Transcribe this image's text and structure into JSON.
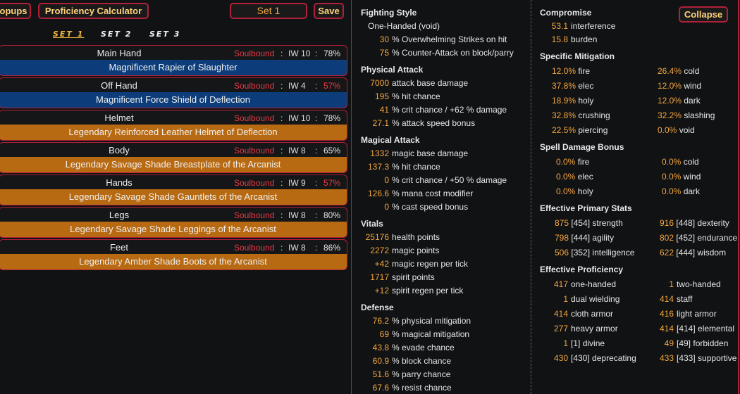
{
  "toolbar": {
    "popups_label": "opups",
    "calculator_label": "Proficiency Calculator",
    "set_name": "Set 1",
    "save_label": "Save"
  },
  "set_tabs": [
    "SET 1",
    "SET 2",
    "SET 3"
  ],
  "slots": [
    {
      "slot": "Main Hand",
      "soulbound": "Soulbound",
      "iw": "IW 10",
      "pct": "78%",
      "pct_low": false,
      "item": "Magnificent Rapier of Slaughter",
      "rarity": "magnificent"
    },
    {
      "slot": "Off Hand",
      "soulbound": "Soulbound",
      "iw": "IW 4",
      "pct": "57%",
      "pct_low": true,
      "item": "Magnificent Force Shield of Deflection",
      "rarity": "magnificent"
    },
    {
      "slot": "Helmet",
      "soulbound": "Soulbound",
      "iw": "IW 10",
      "pct": "78%",
      "pct_low": false,
      "item": "Legendary Reinforced Leather Helmet of Deflection",
      "rarity": "legendary"
    },
    {
      "slot": "Body",
      "soulbound": "Soulbound",
      "iw": "IW 8",
      "pct": "65%",
      "pct_low": false,
      "item": "Legendary Savage Shade Breastplate of the Arcanist",
      "rarity": "legendary"
    },
    {
      "slot": "Hands",
      "soulbound": "Soulbound",
      "iw": "IW 9",
      "pct": "57%",
      "pct_low": true,
      "item": "Legendary Savage Shade Gauntlets of the Arcanist",
      "rarity": "legendary"
    },
    {
      "slot": "Legs",
      "soulbound": "Soulbound",
      "iw": "IW 8",
      "pct": "80%",
      "pct_low": false,
      "item": "Legendary Savage Shade Leggings of the Arcanist",
      "rarity": "legendary"
    },
    {
      "slot": "Feet",
      "soulbound": "Soulbound",
      "iw": "IW 8",
      "pct": "86%",
      "pct_low": false,
      "item": "Legendary Amber Shade Boots of the Arcanist",
      "rarity": "legendary"
    }
  ],
  "fighting_style": {
    "title": "Fighting Style",
    "style": "One-Handed (void)",
    "rows": [
      {
        "v": "30",
        "t": "% Overwhelming Strikes on hit"
      },
      {
        "v": "75",
        "t": "% Counter-Attack on block/parry"
      }
    ]
  },
  "physical_attack": {
    "title": "Physical Attack",
    "rows": [
      {
        "v": "7000",
        "t": "attack base damage"
      },
      {
        "v": "195",
        "t": "% hit chance"
      },
      {
        "v": "41",
        "t": "% crit chance / +62 % damage"
      },
      {
        "v": "27.1",
        "t": "% attack speed bonus"
      }
    ]
  },
  "magical_attack": {
    "title": "Magical Attack",
    "rows": [
      {
        "v": "1332",
        "t": "magic base damage"
      },
      {
        "v": "137.3",
        "t": "% hit chance"
      },
      {
        "v": "0",
        "t": "% crit chance / +50 % damage"
      },
      {
        "v": "126.6",
        "t": "% mana cost modifier"
      },
      {
        "v": "0",
        "t": "% cast speed bonus"
      }
    ]
  },
  "vitals": {
    "title": "Vitals",
    "rows": [
      {
        "v": "25176",
        "t": "health points"
      },
      {
        "v": "2272",
        "t": "magic points"
      },
      {
        "v": "+42",
        "t": "magic regen per tick"
      },
      {
        "v": "1717",
        "t": "spirit points"
      },
      {
        "v": "+12",
        "t": "spirit regen per tick"
      }
    ]
  },
  "defense": {
    "title": "Defense",
    "rows": [
      {
        "v": "76.2",
        "t": "% physical mitigation"
      },
      {
        "v": "69",
        "t": "% magical mitigation"
      },
      {
        "v": "43.8",
        "t": "% evade chance"
      },
      {
        "v": "60.9",
        "t": "% block chance"
      },
      {
        "v": "51.6",
        "t": "% parry chance"
      },
      {
        "v": "67.6",
        "t": "% resist chance"
      }
    ]
  },
  "compromise": {
    "title": "Compromise",
    "collapse_label": "Collapse",
    "rows": [
      {
        "v": "53.1",
        "t": "interference"
      },
      {
        "v": "15.8",
        "t": "burden"
      }
    ]
  },
  "specific_mitigation": {
    "title": "Specific Mitigation",
    "left": [
      {
        "v": "12.0%",
        "t": "fire"
      },
      {
        "v": "37.8%",
        "t": "elec"
      },
      {
        "v": "18.9%",
        "t": "holy"
      },
      {
        "v": "32.8%",
        "t": "crushing"
      },
      {
        "v": "22.5%",
        "t": "piercing"
      }
    ],
    "right": [
      {
        "v": "26.4%",
        "t": "cold"
      },
      {
        "v": "12.0%",
        "t": "wind"
      },
      {
        "v": "12.0%",
        "t": "dark"
      },
      {
        "v": "32.2%",
        "t": "slashing"
      },
      {
        "v": "0.0%",
        "t": "void"
      }
    ]
  },
  "spell_damage": {
    "title": "Spell Damage Bonus",
    "left": [
      {
        "v": "0.0%",
        "t": "fire"
      },
      {
        "v": "0.0%",
        "t": "elec"
      },
      {
        "v": "0.0%",
        "t": "holy"
      }
    ],
    "right": [
      {
        "v": "0.0%",
        "t": "cold"
      },
      {
        "v": "0.0%",
        "t": "wind"
      },
      {
        "v": "0.0%",
        "t": "dark"
      }
    ]
  },
  "primary_stats": {
    "title": "Effective Primary Stats",
    "left": [
      {
        "v": "875",
        "b": "[454]",
        "t": "strength"
      },
      {
        "v": "798",
        "b": "[444]",
        "t": "agility"
      },
      {
        "v": "506",
        "b": "[352]",
        "t": "intelligence"
      }
    ],
    "right": [
      {
        "v": "916",
        "b": "[448]",
        "t": "dexterity"
      },
      {
        "v": "802",
        "b": "[452]",
        "t": "endurance"
      },
      {
        "v": "622",
        "b": "[444]",
        "t": "wisdom"
      }
    ]
  },
  "proficiency": {
    "title": "Effective Proficiency",
    "left": [
      {
        "v": "417",
        "b": "",
        "t": "one-handed"
      },
      {
        "v": "1",
        "b": "",
        "t": "dual wielding"
      },
      {
        "v": "414",
        "b": "",
        "t": "cloth armor"
      },
      {
        "v": "277",
        "b": "",
        "t": "heavy armor"
      },
      {
        "v": "1",
        "b": "[1]",
        "t": "divine"
      },
      {
        "v": "430",
        "b": "[430]",
        "t": "deprecating"
      }
    ],
    "right": [
      {
        "v": "1",
        "b": "",
        "t": "two-handed"
      },
      {
        "v": "414",
        "b": "",
        "t": "staff"
      },
      {
        "v": "416",
        "b": "",
        "t": "light armor"
      },
      {
        "v": "414",
        "b": "[414]",
        "t": "elemental"
      },
      {
        "v": "49",
        "b": "[49]",
        "t": "forbidden"
      },
      {
        "v": "433",
        "b": "[433]",
        "t": "supportive"
      }
    ]
  }
}
